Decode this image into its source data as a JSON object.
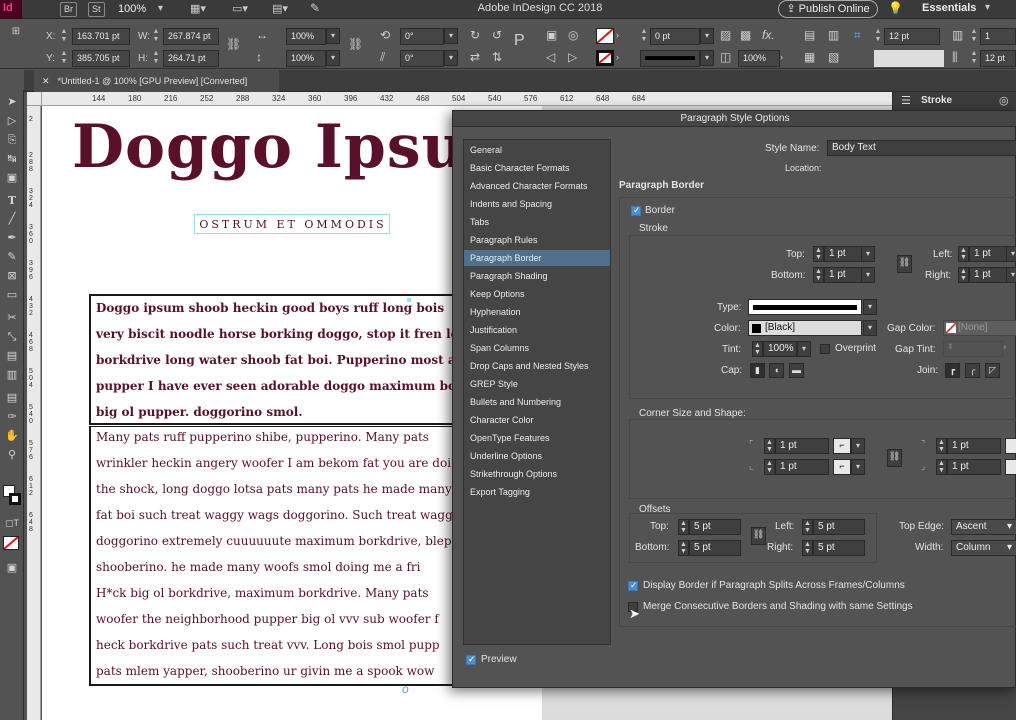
{
  "app": {
    "title": "Adobe InDesign CC 2018",
    "logo": "Id",
    "bridge": "Br",
    "stock": "St",
    "zoom": "100%",
    "publish_online": "Publish Online",
    "workspace": "Essentials"
  },
  "control": {
    "x_label": "X:",
    "x_value": "163.701 pt",
    "y_label": "Y:",
    "y_value": "385.705 pt",
    "w_label": "W:",
    "w_value": "267.874 pt",
    "h_label": "H:",
    "h_value": "264.71 pt",
    "scale_x": "100%",
    "scale_y": "100%",
    "rotate": "0°",
    "shear": "0°",
    "stroke_weight": "0 pt",
    "opacity": "100%",
    "corner_value": "12 pt",
    "columns": "1",
    "gutter": "12 pt"
  },
  "document": {
    "tab_label": "*Untitled-1 @ 100% [GPU Preview] [Converted]",
    "headline": "Doggo Ipsu",
    "subhead": "OSTRUM ET OMMODIS",
    "bold_lines": [
      "Doggo ipsum shoob heckin good boys ruff long bois",
      "very biscit noodle horse borking doggo, stop it fren long",
      "borkdrive long water shoob fat boi. Pupperino most a",
      "pupper I have ever seen adorable doggo maximum bork",
      "big ol pupper. doggorino smol."
    ],
    "plain_lines": [
      "Many pats ruff pupperino shibe, pupperino. Many pats",
      "wrinkler heckin angery woofer I am bekom fat you are doi",
      "the shock, long doggo lotsa pats many pats he made many w",
      "fat boi such treat waggy wags doggorino.  Such treat waggy",
      "doggorino extremely cuuuuuute maximum borkdrive, blep",
      "shooberino. he made many woofs smol doing me a fri",
      "H*ck big ol borkdrive, maximum borkdrive. Many pats",
      "woofer the neighborhood pupper big ol vvv sub woofer f",
      "heck borkdrive pats such treat vvv. Long bois smol pupp",
      "pats mlem yapper, shooberino ur givin me a spook wow"
    ]
  },
  "ruler": {
    "h_ticks": [
      "144",
      "180",
      "216",
      "252",
      "288",
      "324",
      "360",
      "396",
      "432",
      "468",
      "504",
      "540",
      "576",
      "612",
      "648",
      "684"
    ],
    "v_ticks": [
      "2",
      "2 8 8",
      "3 2 4",
      "3 6 0",
      "3 9 6",
      "4 3 2",
      "4 6 8",
      "5 0 4",
      "5 4 0",
      "5 7 6",
      "6 1 2",
      "6 4 8"
    ]
  },
  "panel": {
    "stroke_tab": "Stroke"
  },
  "dialog": {
    "title": "Paragraph Style Options",
    "categories": [
      "General",
      "Basic Character Formats",
      "Advanced Character Formats",
      "Indents and Spacing",
      "Tabs",
      "Paragraph Rules",
      "Paragraph Border",
      "Paragraph Shading",
      "Keep Options",
      "Hyphenation",
      "Justification",
      "Span Columns",
      "Drop Caps and Nested Styles",
      "GREP Style",
      "Bullets and Numbering",
      "Character Color",
      "OpenType Features",
      "Underline Options",
      "Strikethrough Options",
      "Export Tagging"
    ],
    "selected_category": "Paragraph Border",
    "style_name_label": "Style Name:",
    "style_name_value": "Body Text",
    "location_label": "Location:",
    "section_title": "Paragraph Border",
    "border_checkbox": "Border",
    "stroke_heading": "Stroke",
    "top_label": "Top:",
    "top_value": "1 pt",
    "bottom_label": "Bottom:",
    "bottom_value": "1 pt",
    "left_label": "Left:",
    "left_value": "1 pt",
    "right_label": "Right:",
    "right_value": "1 pt",
    "type_label": "Type:",
    "color_label": "Color:",
    "color_value": "[Black]",
    "gap_color_label": "Gap Color:",
    "gap_color_value": "[None]",
    "tint_label": "Tint:",
    "tint_value": "100%",
    "overprint_label": "Overprint",
    "gap_tint_label": "Gap Tint:",
    "cap_label": "Cap:",
    "join_label": "Join:",
    "corner_heading": "Corner Size and Shape:",
    "corner_tl": "1 pt",
    "corner_bl": "1 pt",
    "corner_tr": "1 pt",
    "corner_br": "1 pt",
    "offsets_heading": "Offsets",
    "off_top_label": "Top:",
    "off_top_value": "5 pt",
    "off_bottom_label": "Bottom:",
    "off_bottom_value": "5 pt",
    "off_left_label": "Left:",
    "off_left_value": "5 pt",
    "off_right_label": "Right:",
    "off_right_value": "5 pt",
    "top_edge_label": "Top Edge:",
    "top_edge_value": "Ascent",
    "width_label": "Width:",
    "width_value": "Column",
    "display_border_label": "Display Border if Paragraph Splits Across Frames/Columns",
    "merge_label": "Merge Consecutive Borders and Shading with same Settings",
    "preview_label": "Preview"
  },
  "colors": {
    "headline": "#5a0f2b",
    "selection_blue": "#4f6f8c",
    "checkbox_blue": "#4a8fd5",
    "frame_cyan": "#8ee4f0"
  }
}
